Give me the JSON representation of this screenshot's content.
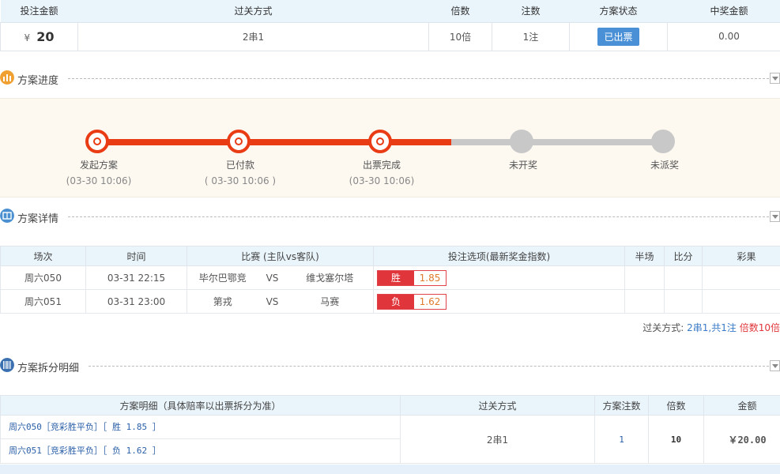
{
  "summary": {
    "headers": [
      "投注金额",
      "过关方式",
      "倍数",
      "注数",
      "方案状态",
      "中奖金额"
    ],
    "currency": "¥",
    "amount": "20",
    "pass_type": "2串1",
    "multiple": "10倍",
    "bets": "1注",
    "status": "已出票",
    "prize": "0.00"
  },
  "sections": {
    "progress_title": "方案进度",
    "detail_title": "方案详情",
    "split_title": "方案拆分明细"
  },
  "progress": {
    "steps": [
      {
        "label": "发起方案",
        "time": "(03-30 10:06)"
      },
      {
        "label": "已付款",
        "time": "( 03-30 10:06 )"
      },
      {
        "label": "出票完成",
        "time": "(03-30 10:06)"
      },
      {
        "label": "未开奖",
        "time": ""
      },
      {
        "label": "未派奖",
        "time": ""
      }
    ],
    "completed_steps": 3,
    "colors": {
      "done": "#e93c15",
      "todo": "#c8c8c8"
    }
  },
  "detail": {
    "headers": [
      "场次",
      "时间",
      "比赛 (主队vs客队)",
      "投注选项(最新奖金指数)",
      "半场",
      "比分",
      "彩果"
    ],
    "rows": [
      {
        "match": "周六050",
        "time": "03-31 22:15",
        "home": "毕尔巴鄂竞",
        "vs": "VS",
        "away": "维戈塞尔塔",
        "result": "胜",
        "odds": "1.85",
        "half": "",
        "score": "",
        "outcome": ""
      },
      {
        "match": "周六051",
        "time": "03-31 23:00",
        "home": "第戎",
        "vs": "VS",
        "away": "马赛",
        "result": "负",
        "odds": "1.62",
        "half": "",
        "score": "",
        "outcome": ""
      }
    ],
    "pass_label": "过关方式: ",
    "pass_value": "2串1,共1注",
    "multiple_text": "倍数10倍"
  },
  "split": {
    "headers": [
      "方案明细（具体赔率以出票拆分为准）",
      "过关方式",
      "方案注数",
      "倍数",
      "金额"
    ],
    "lines": [
      "周六050［竞彩胜平负］［ 胜 1.85 ］",
      "周六051［竞彩胜平负］［ 负 1.62 ］"
    ],
    "pass_type": "2串1",
    "bets": "1",
    "multiple": "10",
    "amount": "￥20.00"
  },
  "colors": {
    "accent": "#e93c15",
    "header_bg": "#eaf4fb",
    "link": "#2a5fa8",
    "status_button": "#4a90d6"
  }
}
